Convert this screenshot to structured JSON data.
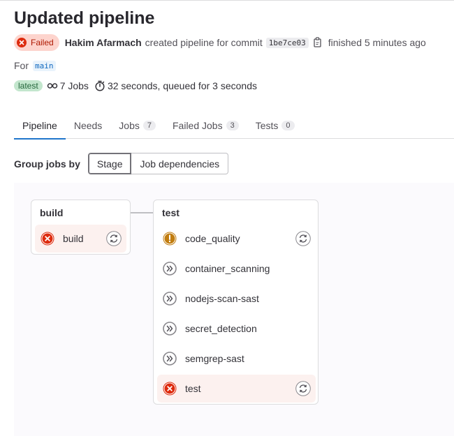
{
  "page": {
    "title": "Updated pipeline"
  },
  "meta": {
    "status_label": "Failed",
    "author": "Hakim Afarmach",
    "action_text": "created pipeline for commit",
    "commit_sha": "1be7ce03",
    "finished_text": "finished 5 minutes ago"
  },
  "ref": {
    "for_label": "For",
    "branch": "main"
  },
  "info": {
    "latest_badge": "latest",
    "jobs_text": "7 Jobs",
    "duration_text": "32 seconds, queued for 3 seconds"
  },
  "tabs": [
    {
      "label": "Pipeline",
      "count": null
    },
    {
      "label": "Needs",
      "count": null
    },
    {
      "label": "Jobs",
      "count": "7"
    },
    {
      "label": "Failed Jobs",
      "count": "3"
    },
    {
      "label": "Tests",
      "count": "0"
    }
  ],
  "grouping": {
    "label": "Group jobs by",
    "option_stage": "Stage",
    "option_dependencies": "Job dependencies"
  },
  "stages": [
    {
      "name": "build",
      "jobs": [
        {
          "name": "build",
          "status": "failed",
          "icon": "failed-icon",
          "action": "retry-icon"
        }
      ]
    },
    {
      "name": "test",
      "jobs": [
        {
          "name": "code_quality",
          "status": "warning",
          "icon": "warning-icon",
          "action": "retry-icon"
        },
        {
          "name": "container_scanning",
          "status": "skipped",
          "icon": "skipped-icon",
          "action": null
        },
        {
          "name": "nodejs-scan-sast",
          "status": "skipped",
          "icon": "skipped-icon",
          "action": null
        },
        {
          "name": "secret_detection",
          "status": "skipped",
          "icon": "skipped-icon",
          "action": null
        },
        {
          "name": "semgrep-sast",
          "status": "skipped",
          "icon": "skipped-icon",
          "action": null
        },
        {
          "name": "test",
          "status": "failed",
          "icon": "failed-icon",
          "action": "retry-icon"
        }
      ]
    }
  ],
  "colors": {
    "failed": "#dd2b0e",
    "warning": "#c17d10",
    "skipped": "#737278",
    "accent": "#1f75cb"
  }
}
